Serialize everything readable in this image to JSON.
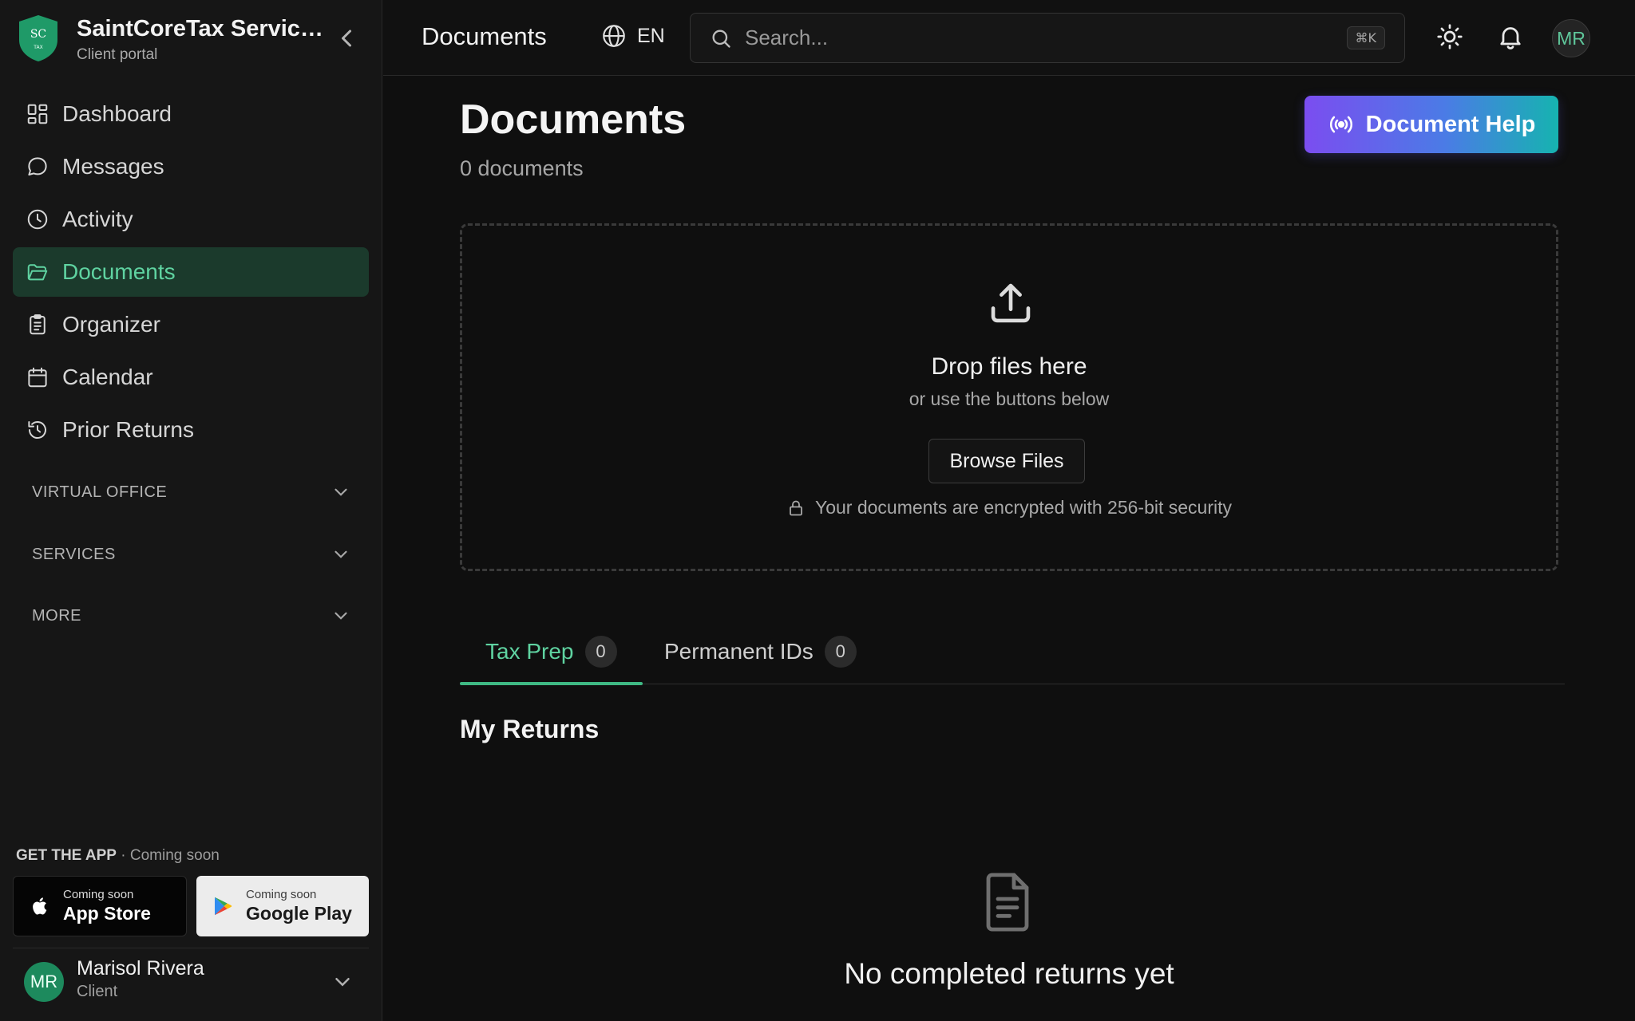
{
  "brand": {
    "logo_text_top": "SC",
    "logo_text_bottom": "TAX",
    "name": "SaintCoreTax Servic…",
    "subtitle": "Client portal"
  },
  "sidebar": {
    "items": [
      {
        "label": "Dashboard",
        "icon": "dashboard-icon"
      },
      {
        "label": "Messages",
        "icon": "message-icon"
      },
      {
        "label": "Activity",
        "icon": "clock-icon"
      },
      {
        "label": "Documents",
        "icon": "folder-icon",
        "active": true
      },
      {
        "label": "Organizer",
        "icon": "clipboard-icon"
      },
      {
        "label": "Calendar",
        "icon": "calendar-icon"
      },
      {
        "label": "Prior Returns",
        "icon": "history-icon"
      }
    ],
    "sections": [
      {
        "label": "VIRTUAL OFFICE"
      },
      {
        "label": "SERVICES"
      },
      {
        "label": "MORE"
      }
    ],
    "get_app": {
      "title": "GET THE APP",
      "note": "· Coming soon"
    },
    "stores": [
      {
        "small": "Coming soon",
        "name": "App Store"
      },
      {
        "small": "Coming soon",
        "name": "Google Play"
      }
    ],
    "user": {
      "initials": "MR",
      "name": "Marisol Rivera",
      "role": "Client"
    }
  },
  "topbar": {
    "title": "Documents",
    "language": "EN",
    "search_placeholder": "Search...",
    "shortcut": "⌘K",
    "avatar_initials": "MR"
  },
  "main": {
    "title": "Documents",
    "count": "0 documents",
    "help_button": "Document Help",
    "dropzone": {
      "title": "Drop files here",
      "subtitle": "or use the buttons below",
      "browse": "Browse Files",
      "security": "Your documents are encrypted with 256-bit security"
    },
    "tabs": [
      {
        "label": "Tax Prep",
        "count": "0",
        "active": true
      },
      {
        "label": "Permanent IDs",
        "count": "0"
      }
    ],
    "section_title": "My Returns",
    "empty_text": "No completed returns yet"
  },
  "colors": {
    "accent": "#5fd3a1",
    "active_bg": "#1b3a2c",
    "background": "#0f0f0f",
    "sidebar_bg": "#161616",
    "help_gradient_start": "#7b4df0",
    "help_gradient_end": "#16b3b0"
  }
}
